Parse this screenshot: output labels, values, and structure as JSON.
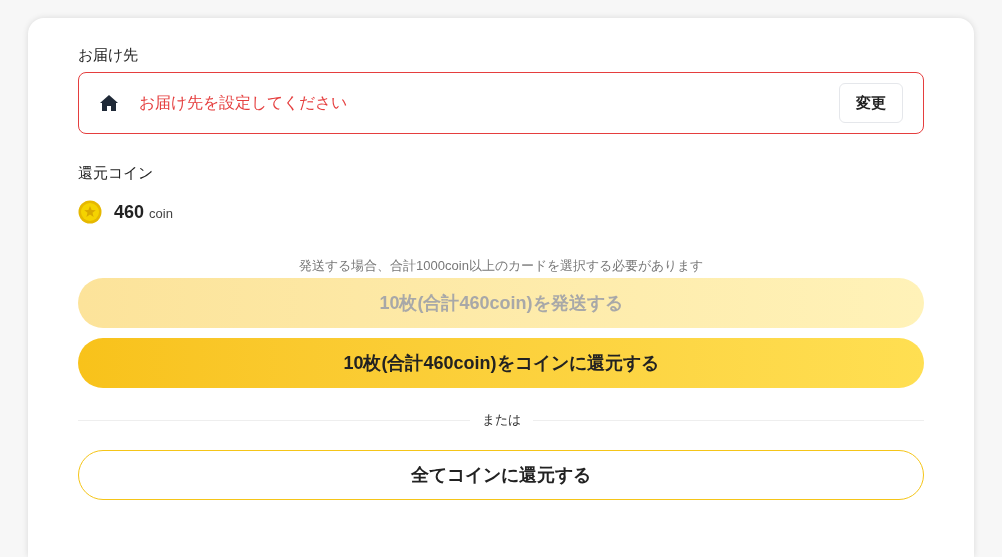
{
  "delivery": {
    "label": "お届け先",
    "placeholder": "お届け先を設定してください",
    "change_button": "変更"
  },
  "coins": {
    "label": "還元コイン",
    "amount": "460",
    "unit": "coin"
  },
  "note": "発送する場合、合計1000coin以上のカードを選択する必要があります",
  "actions": [
    {
      "kind": "filled",
      "label": "10枚(合計460coin)を発送する",
      "disabled": true
    },
    {
      "kind": "filled",
      "label": "10枚(合計460coin)をコインに還元する",
      "disabled": false
    }
  ],
  "separator": "または",
  "all_button": {
    "label": "全てコインに還元する"
  }
}
